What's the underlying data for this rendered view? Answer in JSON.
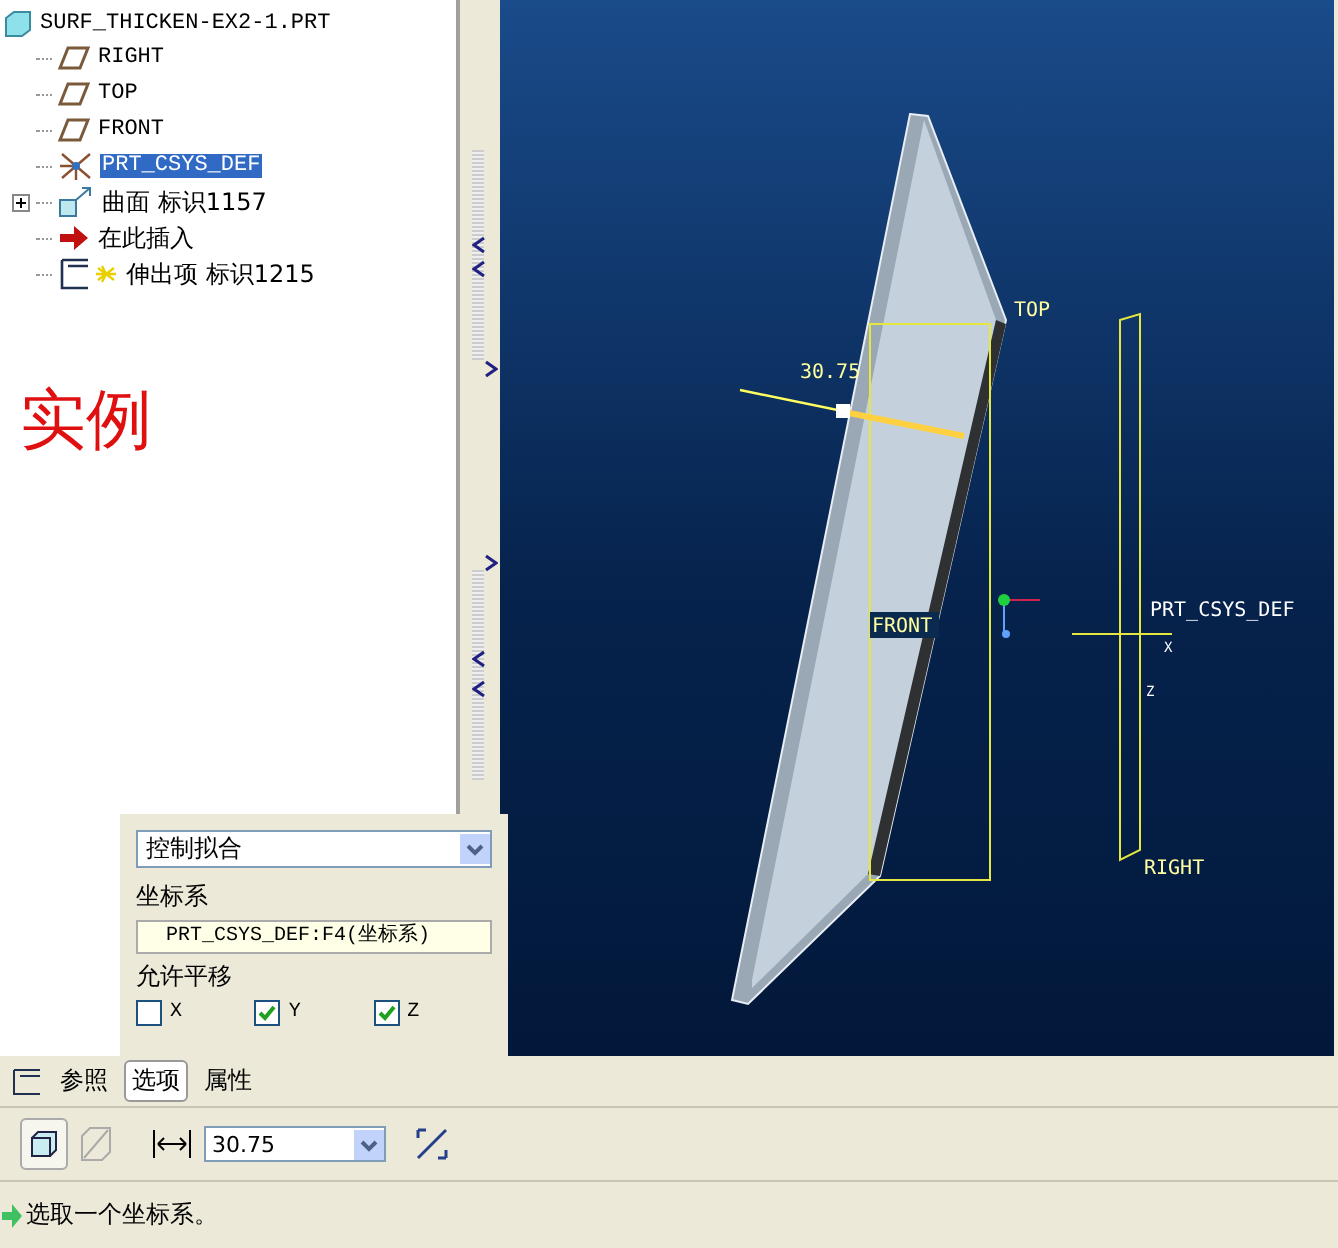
{
  "tree": {
    "root": "SURF_THICKEN-EX2-1.PRT",
    "items": [
      {
        "kind": "plane",
        "label": "RIGHT",
        "selected": false
      },
      {
        "kind": "plane",
        "label": "TOP",
        "selected": false
      },
      {
        "kind": "plane",
        "label": "FRONT",
        "selected": false
      },
      {
        "kind": "csys",
        "label": "PRT_CSYS_DEF",
        "selected": true
      },
      {
        "kind": "surface",
        "label": "曲面 标识1157",
        "selected": false,
        "expanded": false
      },
      {
        "kind": "insert",
        "label": "在此插入",
        "selected": false
      },
      {
        "kind": "extrude",
        "label": "伸出项 标识1215",
        "selected": false
      }
    ]
  },
  "annotation": "实例",
  "viewport": {
    "dimension": "30.75",
    "labels": [
      {
        "kind": "top",
        "text": "TOP"
      },
      {
        "kind": "csys",
        "text": "PRT_CSYS_DEF"
      },
      {
        "kind": "front",
        "text": "FRONT"
      },
      {
        "kind": "axis_x",
        "text": "X"
      },
      {
        "kind": "axis_z",
        "text": "Z"
      },
      {
        "kind": "right",
        "text": "RIGHT"
      }
    ]
  },
  "options_panel": {
    "fit": "控制拟合",
    "csys_label": "坐标系",
    "csys_value": "PRT_CSYS_DEF:F4(坐标系)",
    "translate_label": "允许平移",
    "axes": [
      {
        "label": "X",
        "checked": false
      },
      {
        "label": "Y",
        "checked": true
      },
      {
        "label": "Z",
        "checked": true
      }
    ]
  },
  "tabs": [
    {
      "label": "参照",
      "selected": false
    },
    {
      "label": "选项",
      "selected": true
    },
    {
      "label": "属性",
      "selected": false
    }
  ],
  "toolbar": {
    "thickness": "30.75"
  },
  "status": "选取一个坐标系。"
}
